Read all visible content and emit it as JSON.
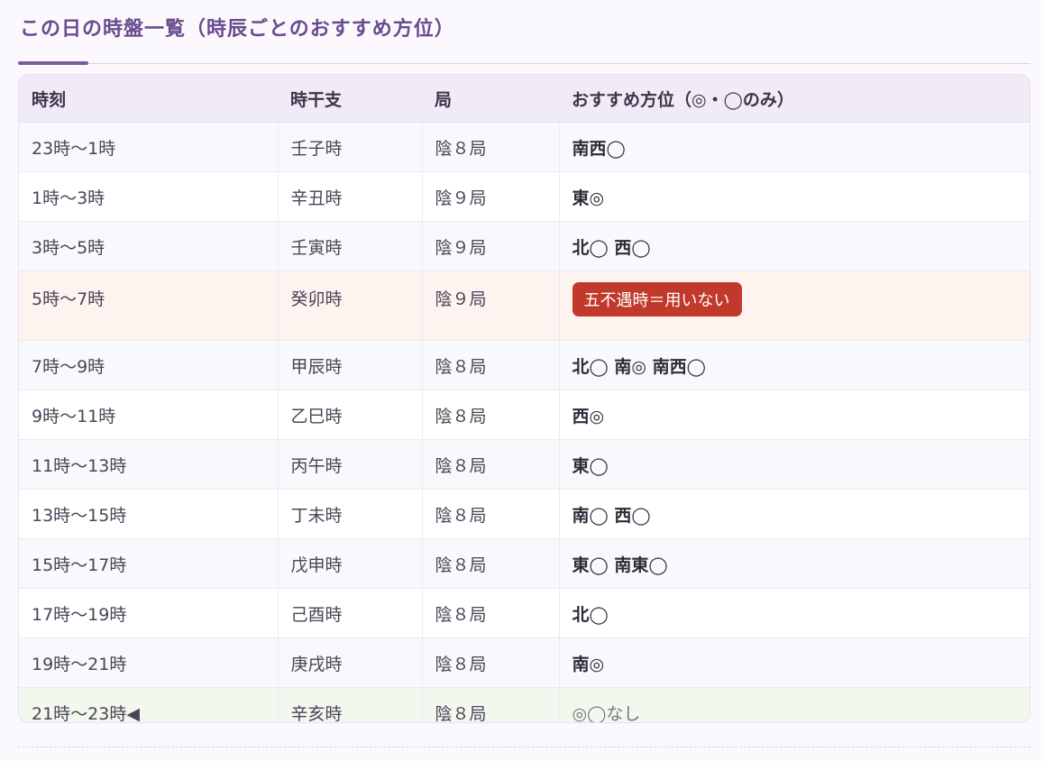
{
  "title": "この日の時盤一覧（時辰ごとのおすすめ方位）",
  "headers": {
    "time": "時刻",
    "stem_branch": "時干支",
    "board": "局",
    "direction": "おすすめ方位（◎・◯のみ）"
  },
  "rows": [
    {
      "time": "23時〜1時",
      "stem_branch": "壬子時",
      "board": "陰８局",
      "direction": "南西◯"
    },
    {
      "time": "1時〜3時",
      "stem_branch": "辛丑時",
      "board": "陰９局",
      "direction": "東◎"
    },
    {
      "time": "3時〜5時",
      "stem_branch": "壬寅時",
      "board": "陰９局",
      "direction": "北◯ 西◯"
    },
    {
      "time": "5時〜7時",
      "stem_branch": "癸卯時",
      "board": "陰９局",
      "direction": "五不遇時＝用いない"
    },
    {
      "time": "7時〜9時",
      "stem_branch": "甲辰時",
      "board": "陰８局",
      "direction": "北◯ 南◎ 南西◯"
    },
    {
      "time": "9時〜11時",
      "stem_branch": "乙巳時",
      "board": "陰８局",
      "direction": "西◎"
    },
    {
      "time": "11時〜13時",
      "stem_branch": "丙午時",
      "board": "陰８局",
      "direction": "東◯"
    },
    {
      "time": "13時〜15時",
      "stem_branch": "丁未時",
      "board": "陰８局",
      "direction": "南◯ 西◯"
    },
    {
      "time": "15時〜17時",
      "stem_branch": "戊申時",
      "board": "陰８局",
      "direction": "東◯ 南東◯"
    },
    {
      "time": "17時〜19時",
      "stem_branch": "己酉時",
      "board": "陰８局",
      "direction": "北◯"
    },
    {
      "time": "19時〜21時",
      "stem_branch": "庚戌時",
      "board": "陰８局",
      "direction": "南◎"
    },
    {
      "time": "21時〜23時◀",
      "stem_branch": "辛亥時",
      "board": "陰８局",
      "direction": "◎◯なし"
    }
  ],
  "colors": {
    "accent": "#6a4b8e",
    "header_bg": "#f1ebf8",
    "warning_badge": "#c0392b",
    "current_row_bg": "#f3f8ee",
    "bad_row_bg": "#fdf3ef"
  }
}
